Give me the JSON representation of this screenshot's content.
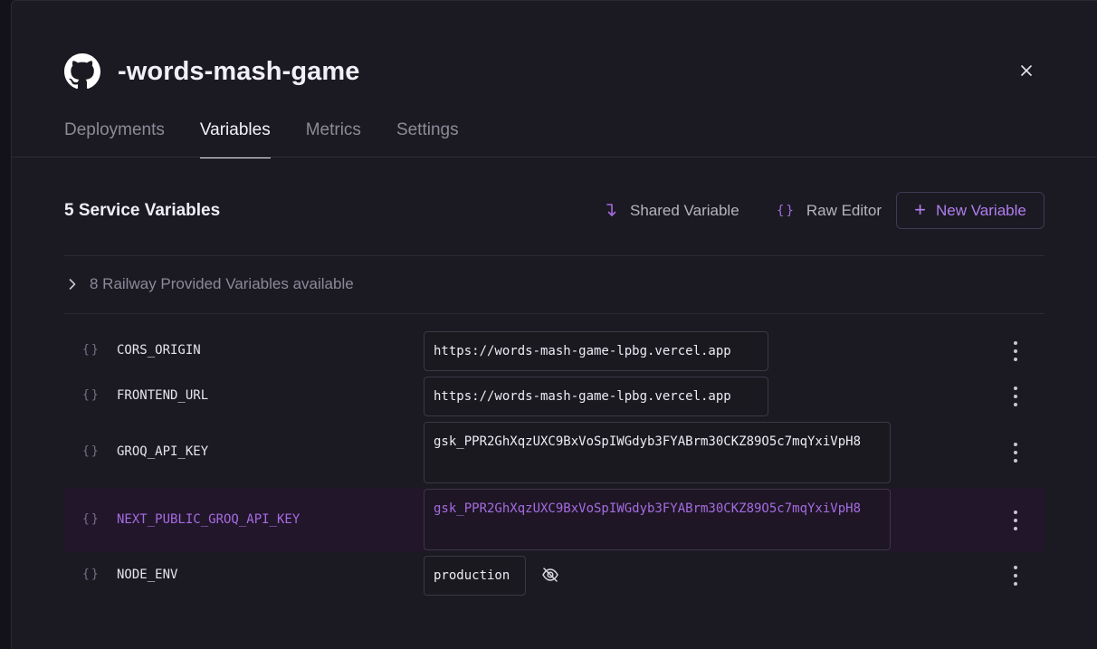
{
  "service": {
    "title": "-words-mash-game"
  },
  "tabs": [
    {
      "label": "Deployments"
    },
    {
      "label": "Variables",
      "active": true
    },
    {
      "label": "Metrics"
    },
    {
      "label": "Settings"
    }
  ],
  "variables_section": {
    "title": "5 Service Variables",
    "shared_variable_label": "Shared Variable",
    "raw_editor_label": "Raw Editor",
    "new_variable_label": "New Variable",
    "railway_provided_label": "8 Railway Provided Variables available"
  },
  "variables": [
    {
      "icon": "{}",
      "name": "CORS_ORIGIN",
      "value": "https://words-mash-game-lpbg.vercel.app"
    },
    {
      "icon": "{}",
      "name": "FRONTEND_URL",
      "value": "https://words-mash-game-lpbg.vercel.app"
    },
    {
      "icon": "{}",
      "name": "GROQ_API_KEY",
      "value": "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"
    },
    {
      "icon": "{}",
      "name": "NEXT_PUBLIC_GROQ_API_KEY",
      "value": "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",
      "highlighted": true
    },
    {
      "icon": "{}",
      "name": "NODE_ENV",
      "value": "production"
    }
  ],
  "colors": {
    "background": "#1b1a22",
    "accent": "#a66be0",
    "highlight_row": "#22162b",
    "text_primary": "#f0eef4",
    "text_muted": "#8d8a98"
  },
  "icons": {
    "brand": "github-icon",
    "close": "close-icon",
    "shared": "arrow-turn-down-right-icon",
    "raw_editor": "braces-icon",
    "new": "plus-icon",
    "expand": "chevron-right-icon",
    "row_menu": "more-vertical-icon",
    "toggle_visibility": "eye-off-icon"
  }
}
